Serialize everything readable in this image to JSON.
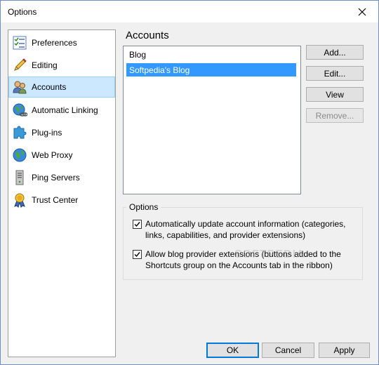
{
  "window": {
    "title": "Options"
  },
  "nav": {
    "items": [
      {
        "label": "Preferences",
        "icon": "preferences-icon",
        "selected": false
      },
      {
        "label": "Editing",
        "icon": "pencil-icon",
        "selected": false
      },
      {
        "label": "Accounts",
        "icon": "users-icon",
        "selected": true
      },
      {
        "label": "Automatic Linking",
        "icon": "globe-link-icon",
        "selected": false
      },
      {
        "label": "Plug-ins",
        "icon": "puzzle-icon",
        "selected": false
      },
      {
        "label": "Web Proxy",
        "icon": "globe-icon",
        "selected": false
      },
      {
        "label": "Ping Servers",
        "icon": "server-icon",
        "selected": false
      },
      {
        "label": "Trust Center",
        "icon": "ribbon-icon",
        "selected": false
      }
    ]
  },
  "main": {
    "title": "Accounts",
    "accounts": [
      {
        "label": "Blog",
        "selected": false
      },
      {
        "label": "Softpedia's Blog",
        "selected": true
      }
    ],
    "buttons": {
      "add": "Add...",
      "edit": "Edit...",
      "view": "View",
      "remove": "Remove..."
    },
    "options_group": {
      "legend": "Options",
      "auto_update": {
        "checked": true,
        "line1": "Automatically update account information (categories,",
        "line2": "links, capabilities, and provider extensions)"
      },
      "allow_extensions": {
        "checked": true,
        "line1": "Allow blog provider extensions (buttons added to the",
        "line2": "Shortcuts group on the Accounts tab in the ribbon)"
      }
    }
  },
  "watermark": "SOFTPEDIA",
  "footer": {
    "ok": "OK",
    "cancel": "Cancel",
    "apply": "Apply"
  }
}
